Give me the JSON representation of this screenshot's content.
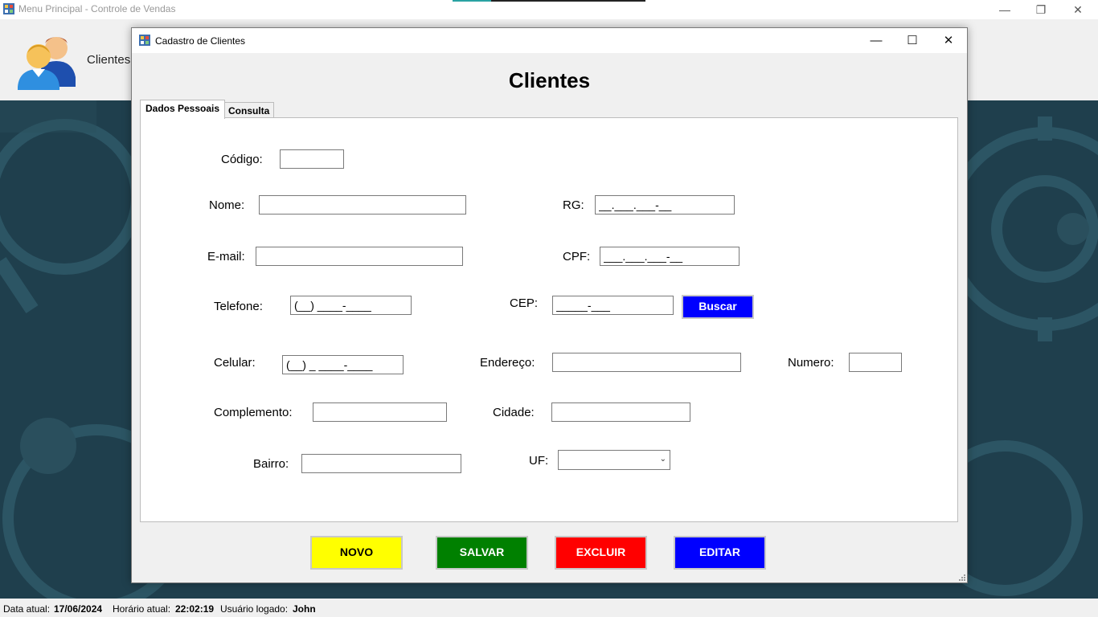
{
  "main_window": {
    "title": "Menu Principal - Controle de Vendas",
    "menu_label": "Clientes"
  },
  "dialog": {
    "title": "Cadastro de Clientes",
    "heading": "Clientes",
    "tabs": [
      {
        "label": "Dados Pessoais",
        "active": true
      },
      {
        "label": "Consulta",
        "active": false
      }
    ]
  },
  "form": {
    "codigo": {
      "label": "Código:",
      "value": ""
    },
    "nome": {
      "label": "Nome:",
      "value": ""
    },
    "rg": {
      "label": "RG:",
      "value": "__.___.___-__"
    },
    "email": {
      "label": "E-mail:",
      "value": ""
    },
    "cpf": {
      "label": "CPF:",
      "value": "___.___.___-__"
    },
    "telefone": {
      "label": "Telefone:",
      "value": "(__) ____-____"
    },
    "cep": {
      "label": "CEP:",
      "value": "_____-___"
    },
    "buscar_label": "Buscar",
    "celular": {
      "label": "Celular:",
      "value": "(__) _ ____-____"
    },
    "endereco": {
      "label": "Endereço:",
      "value": ""
    },
    "numero": {
      "label": "Numero:",
      "value": ""
    },
    "complemento": {
      "label": "Complemento:",
      "value": ""
    },
    "cidade": {
      "label": "Cidade:",
      "value": ""
    },
    "bairro": {
      "label": "Bairro:",
      "value": ""
    },
    "uf": {
      "label": "UF:",
      "value": ""
    }
  },
  "actions": {
    "novo": "NOVO",
    "salvar": "SALVAR",
    "excluir": "EXCLUIR",
    "editar": "EDITAR"
  },
  "statusbar": {
    "data_label": "Data atual:",
    "data_value": "17/06/2024",
    "hora_label": "Horário atual:",
    "hora_value": "22:02:19",
    "usuario_label": "Usuário logado:",
    "usuario_value": "John"
  },
  "colors": {
    "novo": "#ffff00",
    "salvar": "#008000",
    "excluir": "#ff0000",
    "editar": "#0000ff",
    "buscar": "#0000ff",
    "background": "#1f3f4d"
  },
  "icons": {
    "app": "app-window-icon",
    "clients": "users-icon",
    "minimize": "minimize-icon",
    "maximize": "maximize-icon",
    "restore": "restore-icon",
    "close": "close-icon",
    "dropdown": "chevron-down-icon"
  }
}
